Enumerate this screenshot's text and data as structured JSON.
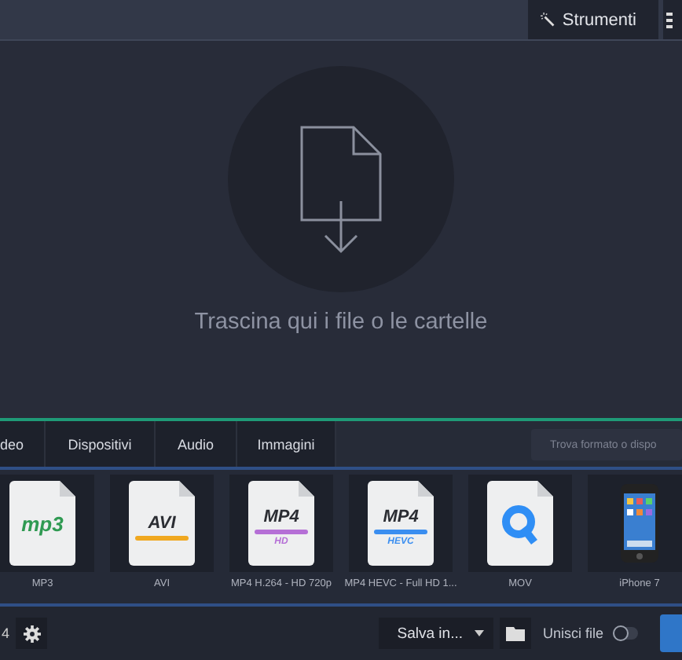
{
  "toolbar": {
    "buttons": [
      {
        "kind": "wand",
        "label": "Strumenti"
      },
      {
        "kind": "menu"
      }
    ]
  },
  "drop_zone": {
    "message": "Trascina qui i file o le cartelle"
  },
  "format_tabs": [
    {
      "label": "deo",
      "selected": false
    },
    {
      "label": "Dispositivi",
      "selected": false
    },
    {
      "label": "Audio",
      "selected": false
    },
    {
      "label": "Immagini",
      "selected": false
    }
  ],
  "format_search": {
    "placeholder": "Trova formato o dispo"
  },
  "formats": [
    {
      "kind": "mp3",
      "icon_text": "mp3",
      "label": "MP3"
    },
    {
      "kind": "avi",
      "icon_text": "AVI",
      "label": "AVI"
    },
    {
      "kind": "mp4",
      "icon_text": "MP4",
      "badge": "HD",
      "color": "#b56fd6",
      "label": "MP4 H.264 - HD 720p"
    },
    {
      "kind": "mp4",
      "icon_text": "MP4",
      "badge": "HEVC",
      "color": "#3a8ef0",
      "label": "MP4 HEVC - Full HD 1..."
    },
    {
      "kind": "mov",
      "label": "MOV"
    },
    {
      "kind": "phone",
      "label": "iPhone 7"
    }
  ],
  "bottom_bar": {
    "left_text": "4",
    "save_label": "Salva in...",
    "merge": {
      "label": "Unisci file",
      "on": false
    }
  }
}
